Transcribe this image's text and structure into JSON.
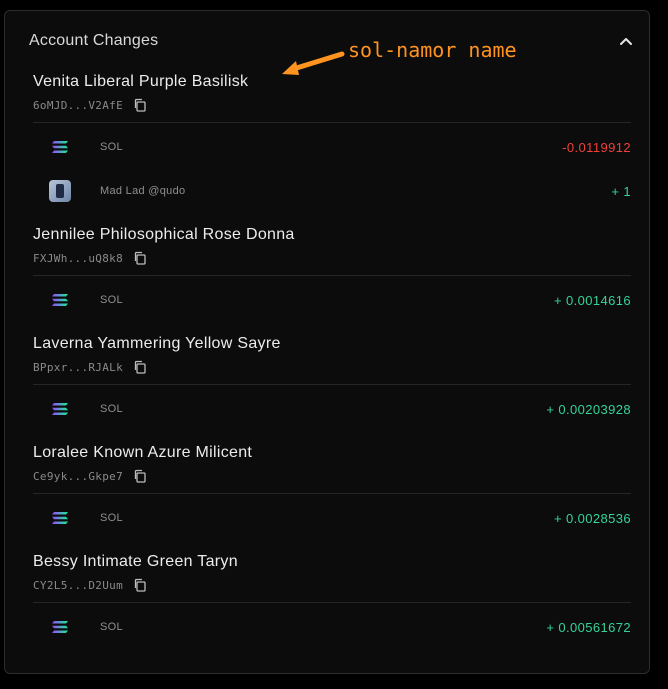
{
  "panel": {
    "title": "Account Changes"
  },
  "annotation": {
    "text": "sol-namor name",
    "color": "#ff9320"
  },
  "colors": {
    "negative": "#f0403a",
    "positive": "#34d399",
    "background": "#000000",
    "panel": "#0c0c0d"
  },
  "accounts": [
    {
      "name": "Venita Liberal Purple Basilisk",
      "address": "6oMJD...V2AfE",
      "changes": [
        {
          "icon": "solana-icon",
          "label": "SOL",
          "amount": "-0.0119912",
          "sign": "negative"
        },
        {
          "icon": "mad-lad-nft-icon",
          "label": "Mad Lad @qudo",
          "amount": "+ 1",
          "sign": "positive"
        }
      ]
    },
    {
      "name": "Jennilee Philosophical Rose Donna",
      "address": "FXJWh...uQ8k8",
      "changes": [
        {
          "icon": "solana-icon",
          "label": "SOL",
          "amount": "+ 0.0014616",
          "sign": "positive"
        }
      ]
    },
    {
      "name": "Laverna Yammering Yellow Sayre",
      "address": "BPpxr...RJALk",
      "changes": [
        {
          "icon": "solana-icon",
          "label": "SOL",
          "amount": "+ 0.00203928",
          "sign": "positive"
        }
      ]
    },
    {
      "name": "Loralee Known Azure Milicent",
      "address": "Ce9yk...Gkpe7",
      "changes": [
        {
          "icon": "solana-icon",
          "label": "SOL",
          "amount": "+ 0.0028536",
          "sign": "positive"
        }
      ]
    },
    {
      "name": "Bessy Intimate Green Taryn",
      "address": "CY2L5...D2Uum",
      "changes": [
        {
          "icon": "solana-icon",
          "label": "SOL",
          "amount": "+ 0.00561672",
          "sign": "positive"
        }
      ]
    }
  ]
}
